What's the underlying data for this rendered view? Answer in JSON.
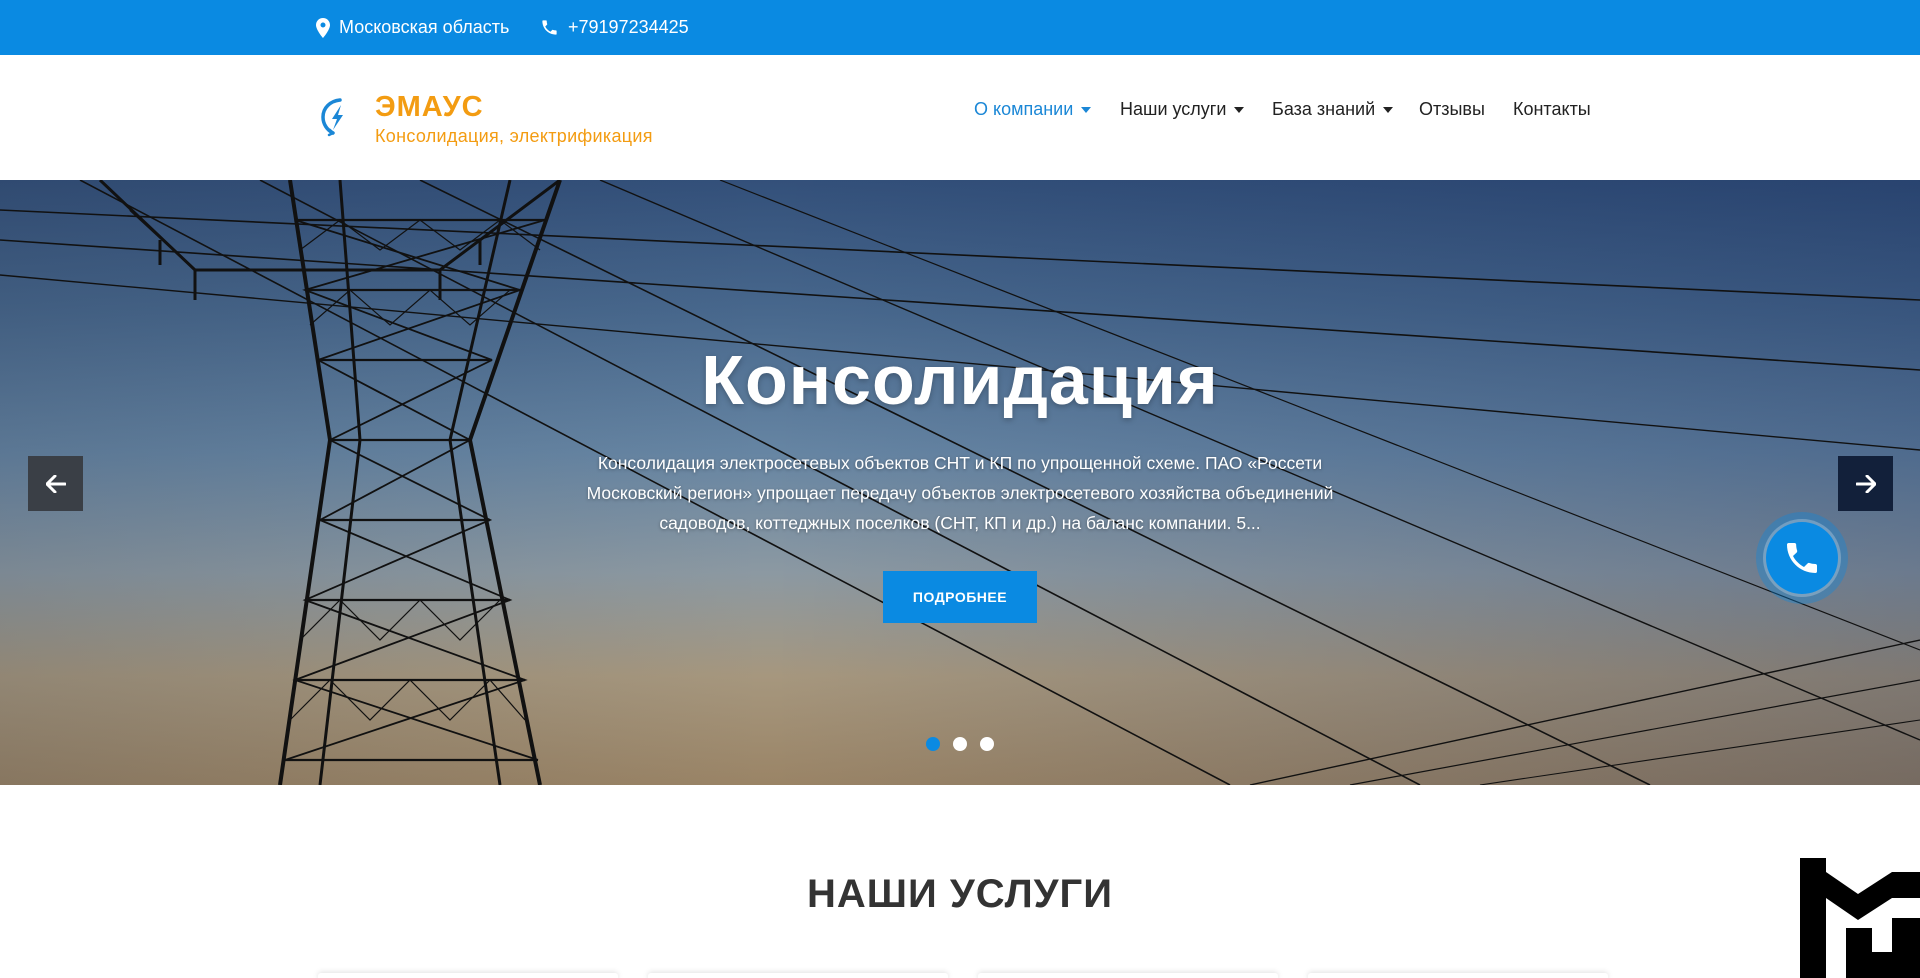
{
  "topbar": {
    "location": "Московская область",
    "phone": "+79197234425",
    "location_icon": "map-pin-icon",
    "phone_icon": "phone-icon"
  },
  "header": {
    "brand_name": "ЭМАУС",
    "brand_tagline": "Консолидация, электрификация",
    "logo_icon": "lightning-bolt-icon",
    "nav": [
      {
        "label": "О компании",
        "dropdown": true,
        "active": true
      },
      {
        "label": "Наши услуги",
        "dropdown": true,
        "active": false
      },
      {
        "label": "База знаний",
        "dropdown": true,
        "active": false
      },
      {
        "label": "Отзывы",
        "dropdown": false,
        "active": false
      },
      {
        "label": "Контакты",
        "dropdown": false,
        "active": false
      }
    ]
  },
  "hero": {
    "title": "Консолидация",
    "text_line1": "Консолидация электросетевых объектов СНТ и КП по упрощенной схеме. ПАО «Россети",
    "text_line2": "Московский регион» упрощает передачу объектов электросетевого хозяйства объединений",
    "text_line3": "садоводов, коттеджных поселков (СНТ, КП и др.) на баланс компании. 5...",
    "button_label": "ПОДРОБНЕЕ",
    "slide_count": 3,
    "active_slide": 1,
    "prev_icon": "arrow-left-icon",
    "next_icon": "arrow-right-icon"
  },
  "call_widget": {
    "icon": "phone-handset-icon"
  },
  "services": {
    "title": "НАШИ УСЛУГИ"
  },
  "colors": {
    "accent": "#0a8ae2",
    "brand": "#f39c12",
    "nav_active": "#1b87d6"
  }
}
